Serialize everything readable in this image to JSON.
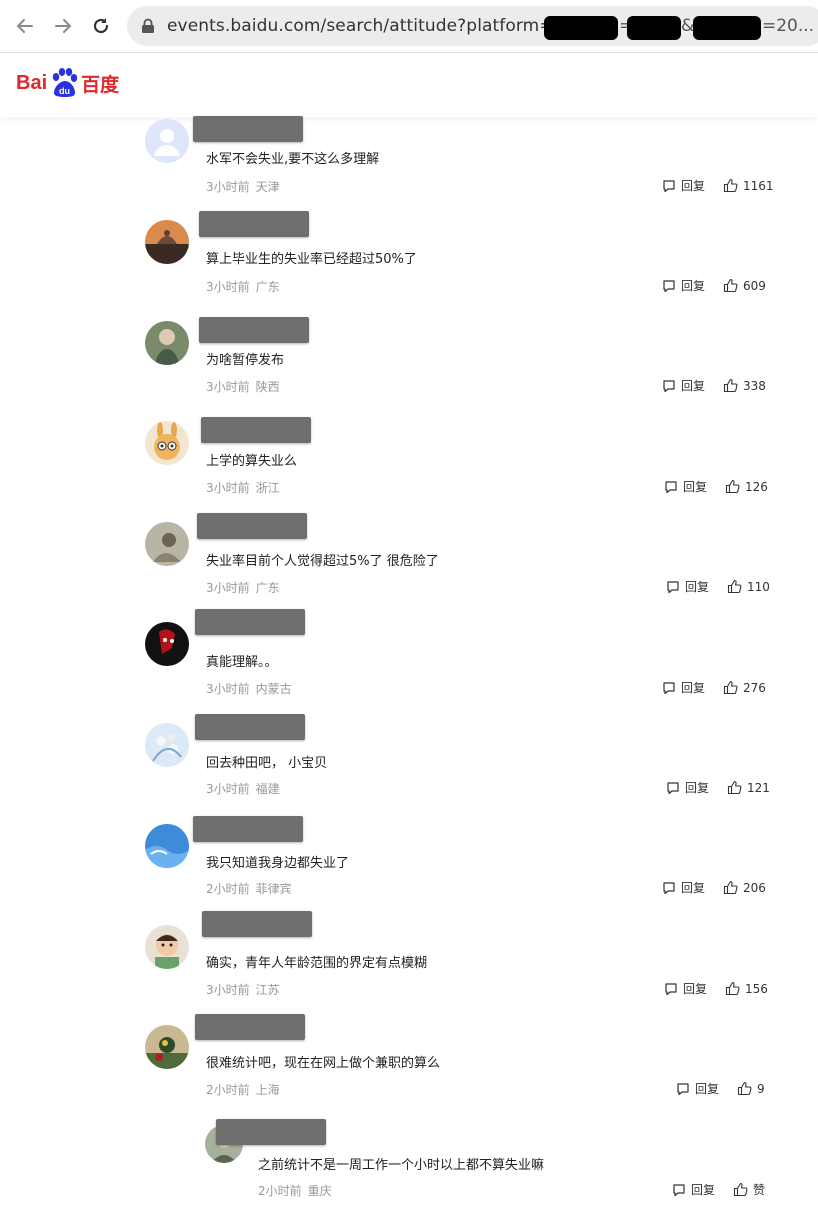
{
  "browser": {
    "url": "events.baidu.com/search/attitude?platform=pc&",
    "url_mid1": "=",
    "url_mid2": "&",
    "url_tail": "=20..."
  },
  "header": {
    "logo_bai": "Bai",
    "logo_du": "du",
    "logo_cn": "百度"
  },
  "reply_label": "回复",
  "comments": [
    {
      "text": "水军不会失业,要不这么多理解",
      "time": "3小时前",
      "location": "天津",
      "likes": "1161"
    },
    {
      "text": "算上毕业生的失业率已经超过50%了",
      "time": "3小时前",
      "location": "广东",
      "likes": "609"
    },
    {
      "text": "为啥暂停发布",
      "time": "3小时前",
      "location": "陕西",
      "likes": "338"
    },
    {
      "text": "上学的算失业么",
      "time": "3小时前",
      "location": "浙江",
      "likes": "126"
    },
    {
      "text": "失业率目前个人觉得超过5%了 很危险了",
      "time": "3小时前",
      "location": "广东",
      "likes": "110"
    },
    {
      "text": "真能理解。。",
      "time": "3小时前",
      "location": "内蒙古",
      "likes": "276"
    },
    {
      "text": "回去种田吧， 小宝贝",
      "time": "3小时前",
      "location": "福建",
      "likes": "121"
    },
    {
      "text": "我只知道我身边都失业了",
      "time": "2小时前",
      "location": "菲律宾",
      "likes": "206"
    },
    {
      "text": "确实，青年人年龄范围的界定有点模糊",
      "time": "3小时前",
      "location": "江苏",
      "likes": "156"
    },
    {
      "text": "很难统计吧，现在在网上做个兼职的算么",
      "time": "2小时前",
      "location": "上海",
      "likes": "9"
    }
  ],
  "sub_comment": {
    "text": "之前统计不是一周工作一个小时以上都不算失业嘛",
    "time": "2小时前",
    "location": "重庆",
    "likes": "赞"
  },
  "colors": {
    "brand": "#e3262b",
    "baidu_blue": "#2932e1",
    "meta": "#999999"
  }
}
